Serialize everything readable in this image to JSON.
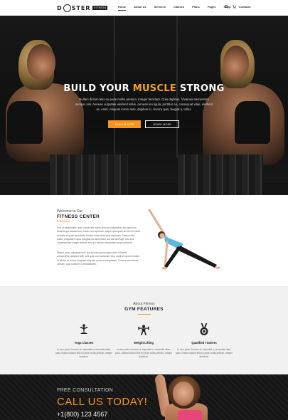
{
  "nav": {
    "logo_left": "D",
    "logo_right": "STER",
    "logo_badge": "FITNESS",
    "items": [
      "Home",
      "About us",
      "Services",
      "Classes",
      "Plans",
      "Pages",
      "Shop",
      "Contacts"
    ],
    "active": "Home",
    "search_icon": "search-icon",
    "cart_icon": "cart-icon"
  },
  "hero": {
    "title_part1": "BUILD YOUR ",
    "title_accent": "MUSCLE",
    "title_part2": " STRONG",
    "text": "Nullam dictum felis eu pede mollis pretium. Integer tincidunt. Cras dapibus. Vivamus elementum semper nisi. Aenean vulputate eleifend tellus. Aenean leo ligula, porttitor eu, consequat vitae, eleifend ac, enim. Aliquam lorem ante, dapibus in, viverra quis, feugiat a, tellus.",
    "join_label": "JOIN US NOW",
    "learn_label": "LEARN MORE"
  },
  "welcome": {
    "small": "Welcome to Our",
    "title": "FITNESS CENTER",
    "p1": "Sed ut perspiciatis unde omnis iste natus error sit voluptatem accusantium doloremque laudantium, totam rem aperiam, eaque ipsa quae ab illo inventore veritatis et quasi architecto beatae vitae dicta sunt explicabo. Nemo enim ipsam voluptatem quia voluptas sit aspernatur aut odit aut fugit, sed quia consequuntur magni dolores eos qui ratione voluptatem sequi nesciunt.",
    "p2": "Neque porro quisquam est, qui dolorem ipsum quia dolor sit amet, consectetur, adipisci velit, sed quia non numquam eius modi tempora incidunt ut labore et dolore magnam aliquam quaerat voluptatem. Ut enim ad minima veniam, quis nostrum exercitationem."
  },
  "features": {
    "small": "About Fitness",
    "title": "GYM FEATURES",
    "items": [
      {
        "name": "Yoga Classes",
        "icon": "yoga-icon",
        "desc": "In arcu justo, rhoncus ut, imperdiet a, venenatis vitae, justo. Nullam dictum felis eu pede mollis pretium. Integer tincidunt."
      },
      {
        "name": "Weight Lifting",
        "icon": "weightlifting-icon",
        "desc": "In arcu justo, rhoncus ut, imperdiet a, venenatis vitae, justo. Nullam dictum felis eu pede mollis pretium. Integer tincidunt."
      },
      {
        "name": "Qualified Trainers",
        "icon": "medal-icon",
        "desc": "In arcu justo, rhoncus ut, imperdiet a, venenatis vitae, justo. Nullam dictum felis eu pede mollis pretium. Integer tincidunt."
      }
    ]
  },
  "cta": {
    "small": "FREE CONSULTATION",
    "big": "CALL US TODAY!",
    "phone": "+1(800) 123 4567"
  },
  "colors": {
    "accent": "#f7941d",
    "dark": "#141414",
    "features_bg": "#f1f1f1"
  }
}
